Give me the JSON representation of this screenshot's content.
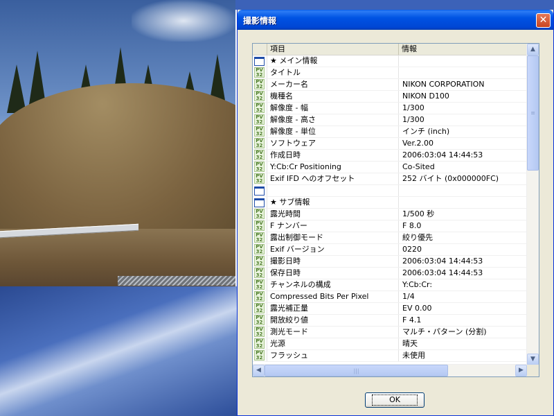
{
  "window": {
    "title": "撮影情報",
    "close_glyph": "✕"
  },
  "list": {
    "columns": [
      "項目",
      "情報"
    ],
    "rows": [
      {
        "icon": "section-icon",
        "name": "★ メイン情報",
        "value": ""
      },
      {
        "icon": "pv-icon",
        "name": "タイトル",
        "value": ""
      },
      {
        "icon": "pv-icon",
        "name": "メーカー名",
        "value": "NIKON CORPORATION"
      },
      {
        "icon": "pv-icon",
        "name": "機種名",
        "value": "NIKON D100"
      },
      {
        "icon": "pv-icon",
        "name": "解像度 - 幅",
        "value": "1/300"
      },
      {
        "icon": "pv-icon",
        "name": "解像度 - 高さ",
        "value": "1/300"
      },
      {
        "icon": "pv-icon",
        "name": "解像度 - 単位",
        "value": "インチ (inch)"
      },
      {
        "icon": "pv-icon",
        "name": "ソフトウェア",
        "value": "Ver.2.00"
      },
      {
        "icon": "pv-icon",
        "name": "作成日時",
        "value": "2006:03:04 14:44:53"
      },
      {
        "icon": "pv-icon",
        "name": "Y:Cb:Cr Positioning",
        "value": "Co-Sited"
      },
      {
        "icon": "pv-icon",
        "name": "Exif IFD へのオフセット",
        "value": "252 バイト (0x000000FC)"
      },
      {
        "icon": "section-icon",
        "name": "",
        "value": ""
      },
      {
        "icon": "section-icon",
        "name": "★ サブ情報",
        "value": ""
      },
      {
        "icon": "pv-icon",
        "name": "露光時間",
        "value": "1/500 秒"
      },
      {
        "icon": "pv-icon",
        "name": "F ナンバー",
        "value": "F 8.0"
      },
      {
        "icon": "pv-icon",
        "name": "露出制御モード",
        "value": "絞り優先"
      },
      {
        "icon": "pv-icon",
        "name": "Exif バージョン",
        "value": "0220"
      },
      {
        "icon": "pv-icon",
        "name": "撮影日時",
        "value": "2006:03:04 14:44:53"
      },
      {
        "icon": "pv-icon",
        "name": "保存日時",
        "value": "2006:03:04 14:44:53"
      },
      {
        "icon": "pv-icon",
        "name": "チャンネルの構成",
        "value": "Y:Cb:Cr:"
      },
      {
        "icon": "pv-icon",
        "name": "Compressed Bits Per Pixel",
        "value": "1/4"
      },
      {
        "icon": "pv-icon",
        "name": "露光補正量",
        "value": "EV 0.00"
      },
      {
        "icon": "pv-icon",
        "name": "開放絞り値",
        "value": "F 4.1"
      },
      {
        "icon": "pv-icon",
        "name": "測光モード",
        "value": "マルチ・パターン (分割)"
      },
      {
        "icon": "pv-icon",
        "name": "光源",
        "value": "晴天"
      },
      {
        "icon": "pv-icon",
        "name": "フラッシュ",
        "value": "未使用"
      }
    ]
  },
  "scrollbar": {
    "up": "▲",
    "down": "▼",
    "left": "◀",
    "right": "▶"
  },
  "ok_label": "OK",
  "icon_text": {
    "pv": "PV\n32"
  },
  "colors": {
    "title_bar": "#0053e3",
    "window_bg": "#ece9d8",
    "close": "#c94420"
  }
}
